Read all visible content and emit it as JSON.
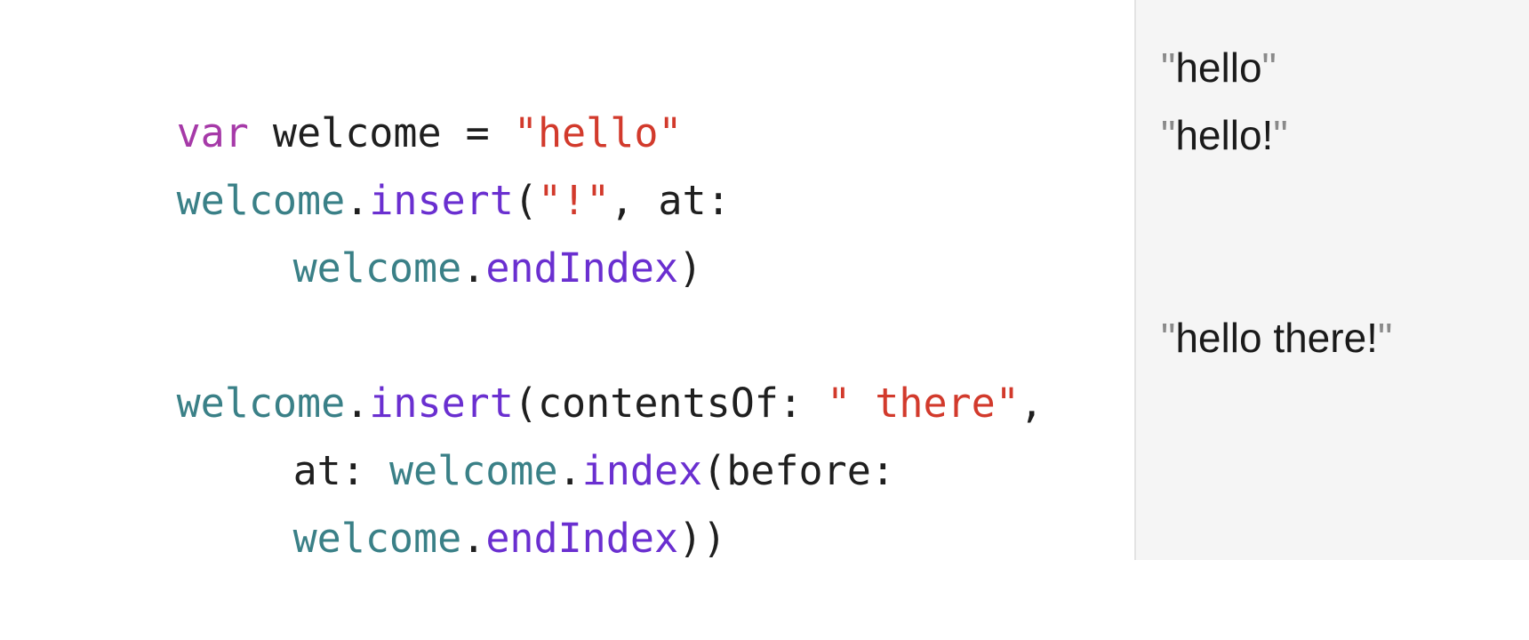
{
  "colors": {
    "keyword": "#a63aa8",
    "variable": "#3a8087",
    "method": "#6a2fd0",
    "string": "#d23a2c",
    "plain": "#1f1f1f",
    "results_bg": "#f5f5f5"
  },
  "code": {
    "lines": [
      {
        "tokens": [
          {
            "text": "var",
            "kind": "keyword"
          },
          {
            "text": " welcome = ",
            "kind": "plain"
          },
          {
            "text": "\"hello\"",
            "kind": "string"
          }
        ]
      },
      {
        "tokens": [
          {
            "text": "welcome",
            "kind": "variable"
          },
          {
            "text": ".",
            "kind": "plain"
          },
          {
            "text": "insert",
            "kind": "method"
          },
          {
            "text": "(",
            "kind": "plain"
          },
          {
            "text": "\"!\"",
            "kind": "string"
          },
          {
            "text": ", at:",
            "kind": "plain"
          }
        ]
      },
      {
        "tokens": [
          {
            "text": "welcome",
            "kind": "variable"
          },
          {
            "text": ".",
            "kind": "plain"
          },
          {
            "text": "endIndex",
            "kind": "method"
          },
          {
            "text": ")",
            "kind": "plain"
          }
        ]
      },
      {
        "tokens": [
          {
            "text": "welcome",
            "kind": "variable"
          },
          {
            "text": ".",
            "kind": "plain"
          },
          {
            "text": "insert",
            "kind": "method"
          },
          {
            "text": "(contentsOf: ",
            "kind": "plain"
          },
          {
            "text": "\" there\"",
            "kind": "string"
          },
          {
            "text": ",",
            "kind": "plain"
          }
        ]
      },
      {
        "tokens": [
          {
            "text": "at: ",
            "kind": "plain"
          },
          {
            "text": "welcome",
            "kind": "variable"
          },
          {
            "text": ".",
            "kind": "plain"
          },
          {
            "text": "index",
            "kind": "method"
          },
          {
            "text": "(before:",
            "kind": "plain"
          }
        ]
      },
      {
        "tokens": [
          {
            "text": "welcome",
            "kind": "variable"
          },
          {
            "text": ".",
            "kind": "plain"
          },
          {
            "text": "endIndex",
            "kind": "method"
          },
          {
            "text": "))",
            "kind": "plain"
          }
        ]
      }
    ]
  },
  "results": {
    "items": [
      {
        "text": "hello"
      },
      {
        "text": "hello!"
      },
      {
        "text": "hello there!"
      }
    ]
  }
}
